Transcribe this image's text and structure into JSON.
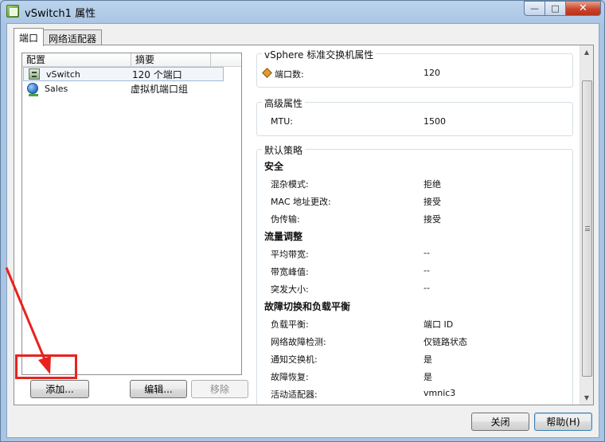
{
  "window": {
    "title": "vSwitch1 属性",
    "controls": {
      "minimize": "—",
      "maximize": "□",
      "close": "✕"
    }
  },
  "tabs": [
    {
      "label": "端口"
    },
    {
      "label": "网络适配器"
    }
  ],
  "list": {
    "columns": [
      "配置",
      "摘要",
      ""
    ],
    "rows": [
      {
        "icon": "switch-icon",
        "name": "vSwitch",
        "summary": "120 个端口"
      },
      {
        "icon": "port-group-icon",
        "name": "Sales",
        "summary": "虚拟机端口组"
      }
    ]
  },
  "list_buttons": {
    "add": "添加...",
    "edit": "编辑...",
    "remove": "移除"
  },
  "properties": {
    "standard_group": {
      "title": "vSphere 标准交换机属性",
      "ports_label": "端口数:",
      "ports_value": "120"
    },
    "advanced_group": {
      "title": "高级属性",
      "mtu_label": "MTU:",
      "mtu_value": "1500"
    },
    "policy_group": {
      "title": "默认策略",
      "security": {
        "heading": "安全",
        "rows": [
          {
            "label": "混杂模式:",
            "value": "拒绝"
          },
          {
            "label": "MAC 地址更改:",
            "value": "接受"
          },
          {
            "label": "伪传输:",
            "value": "接受"
          }
        ]
      },
      "traffic": {
        "heading": "流量调整",
        "rows": [
          {
            "label": "平均带宽:",
            "value": "--"
          },
          {
            "label": "带宽峰值:",
            "value": "--"
          },
          {
            "label": "突发大小:",
            "value": "--"
          }
        ]
      },
      "failover": {
        "heading": "故障切换和负载平衡",
        "rows": [
          {
            "label": "负载平衡:",
            "value": "端口 ID"
          },
          {
            "label": "网络故障检测:",
            "value": "仅链路状态"
          },
          {
            "label": "通知交换机:",
            "value": "是"
          },
          {
            "label": "故障恢复:",
            "value": "是"
          },
          {
            "label": "活动适配器:",
            "value": "vmnic3"
          }
        ]
      }
    }
  },
  "footer": {
    "close": "关闭",
    "help": "帮助(H)"
  },
  "annotation": {
    "color": "#e8221e"
  }
}
